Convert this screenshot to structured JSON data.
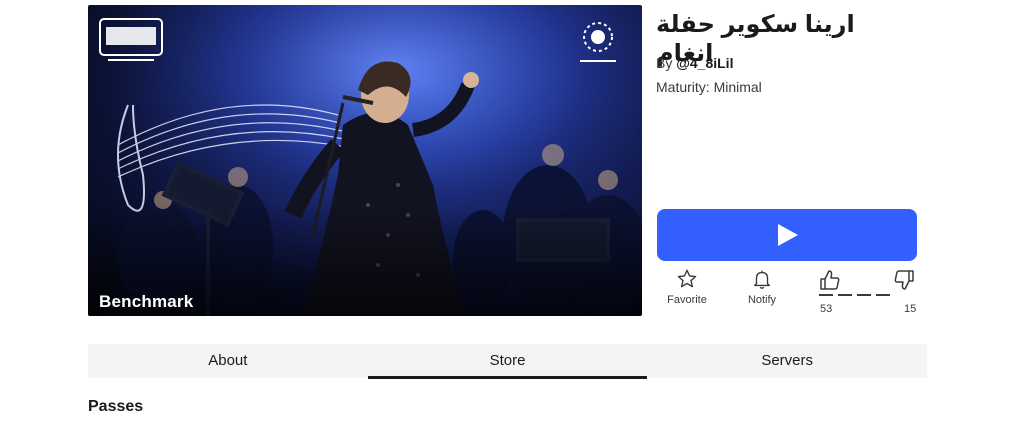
{
  "thumbnail": {
    "watermark_label": "Benchmark",
    "alt": "thumbnail"
  },
  "game": {
    "title": "ارينا سكوير حفلة انغام",
    "by_prefix": "By ",
    "creator": "@4_8iLil",
    "maturity": "Maturity: Minimal"
  },
  "actions": {
    "favorite_label": "Favorite",
    "notify_label": "Notify",
    "upvotes": "53",
    "downvotes": "15",
    "like_ratio": 0.78
  },
  "tabs": [
    {
      "label": "About",
      "active": false
    },
    {
      "label": "Store",
      "active": true
    },
    {
      "label": "Servers",
      "active": false
    }
  ],
  "store": {
    "section_title": "Passes"
  },
  "colors": {
    "play_button": "#335fff",
    "tab_bar": "#f2f4f5",
    "text": "#393b3d"
  }
}
